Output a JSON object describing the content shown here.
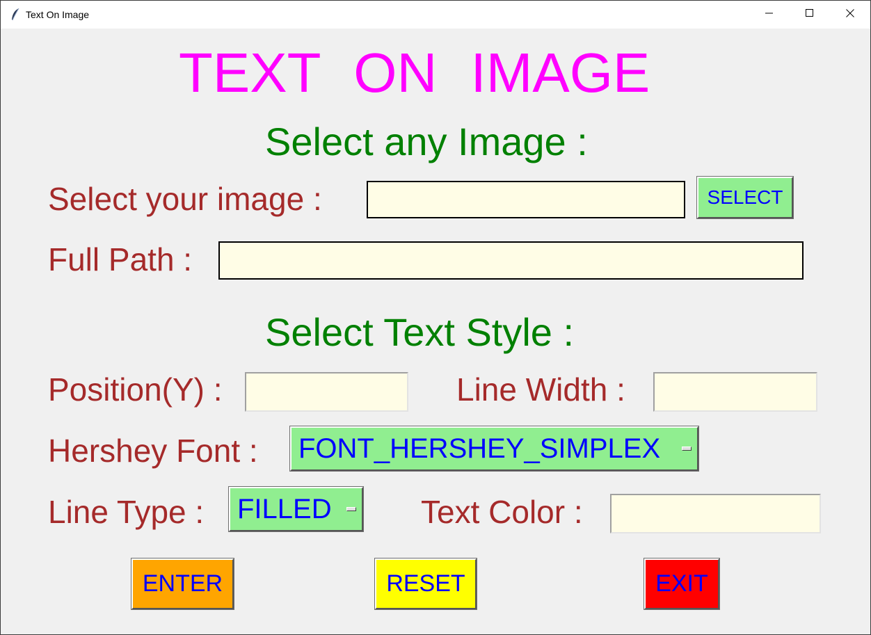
{
  "window": {
    "title": "Text On Image"
  },
  "header": {
    "title": "TEXT ON IMAGE"
  },
  "image_section": {
    "heading": "Select any Image :",
    "select_label": "Select your image  :",
    "select_value": "",
    "select_button": "SELECT",
    "path_label": "Full Path :",
    "path_value": ""
  },
  "style_section": {
    "heading": "Select Text Style :",
    "position_label": "Position(Y) :",
    "position_value": "",
    "line_width_label": "Line Width :",
    "line_width_value": "",
    "font_label": "Hershey Font :",
    "font_value": "FONT_HERSHEY_SIMPLEX",
    "line_type_label": "Line Type :",
    "line_type_value": "FILLED",
    "text_color_label": "Text Color :",
    "text_color_value": ""
  },
  "actions": {
    "enter": "ENTER",
    "reset": "RESET",
    "exit": "EXIT"
  },
  "colors": {
    "title": "#ff00ff",
    "section_heading": "#008000",
    "label": "#a52a2a",
    "entry_bg": "#fffde6",
    "button_text": "#0000ff",
    "select_button_bg": "#90ee90",
    "enter_bg": "#ffa500",
    "reset_bg": "#ffff00",
    "exit_bg": "#ff0000"
  },
  "icons": {
    "app": "feather-icon",
    "minimize": "minimize-icon",
    "maximize": "maximize-icon",
    "close": "close-icon",
    "dropdown": "dropdown-indicator-icon"
  }
}
